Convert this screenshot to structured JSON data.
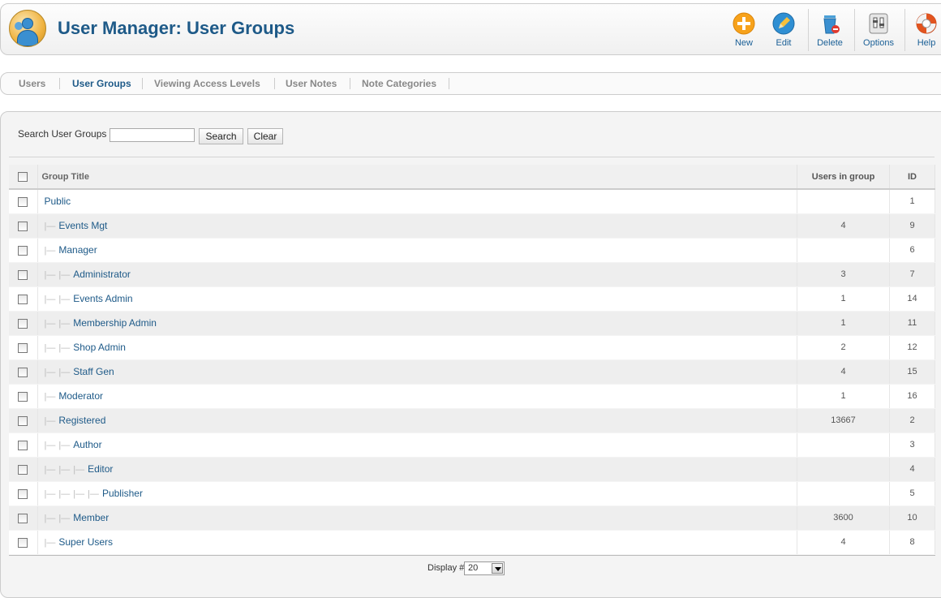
{
  "header": {
    "title": "User Manager: User Groups",
    "buttons": {
      "new": "New",
      "edit": "Edit",
      "delete": "Delete",
      "options": "Options",
      "help": "Help"
    }
  },
  "submenu": {
    "users": "Users",
    "user_groups": "User Groups",
    "viewing_access_levels": "Viewing Access Levels",
    "user_notes": "User Notes",
    "note_categories": "Note Categories"
  },
  "filter": {
    "label": "Search User Groups",
    "value": "",
    "search_button": "Search",
    "clear_button": "Clear"
  },
  "table": {
    "headers": {
      "title": "Group Title",
      "users": "Users in group",
      "id": "ID"
    },
    "rows": [
      {
        "title": "Public",
        "level": 0,
        "users": "",
        "id": "1"
      },
      {
        "title": "Events Mgt",
        "level": 1,
        "users": "4",
        "id": "9"
      },
      {
        "title": "Manager",
        "level": 1,
        "users": "",
        "id": "6"
      },
      {
        "title": "Administrator",
        "level": 2,
        "users": "3",
        "id": "7"
      },
      {
        "title": "Events Admin",
        "level": 2,
        "users": "1",
        "id": "14"
      },
      {
        "title": "Membership Admin",
        "level": 2,
        "users": "1",
        "id": "11"
      },
      {
        "title": "Shop Admin",
        "level": 2,
        "users": "2",
        "id": "12"
      },
      {
        "title": "Staff Gen",
        "level": 2,
        "users": "4",
        "id": "15"
      },
      {
        "title": "Moderator",
        "level": 1,
        "users": "1",
        "id": "16"
      },
      {
        "title": "Registered",
        "level": 1,
        "users": "13667",
        "id": "2"
      },
      {
        "title": "Author",
        "level": 2,
        "users": "",
        "id": "3"
      },
      {
        "title": "Editor",
        "level": 3,
        "users": "",
        "id": "4"
      },
      {
        "title": "Publisher",
        "level": 4,
        "users": "",
        "id": "5"
      },
      {
        "title": "Member",
        "level": 2,
        "users": "3600",
        "id": "10"
      },
      {
        "title": "Super Users",
        "level": 1,
        "users": "4",
        "id": "8"
      }
    ]
  },
  "pagination": {
    "display_label": "Display #",
    "display_value": "20"
  }
}
